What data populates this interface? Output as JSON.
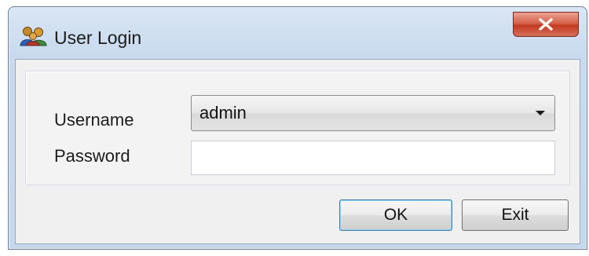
{
  "window": {
    "title": "User Login",
    "title_icon": "users-icon",
    "close_icon": "close-icon",
    "close_symbol": "X"
  },
  "form": {
    "username_label": "Username",
    "username_value": "admin",
    "password_label": "Password",
    "password_value": "",
    "dropdown_icon": "chevron-down-icon"
  },
  "buttons": {
    "ok_label": "OK",
    "exit_label": "Exit"
  },
  "colors": {
    "close_button": "#c84a32",
    "default_button_border": "#3c7fb1",
    "title_bar": "#d9e6f4"
  }
}
